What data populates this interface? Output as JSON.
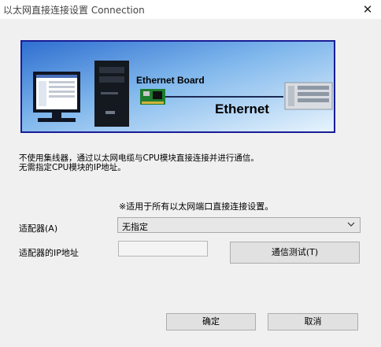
{
  "window": {
    "title": "以太网直接连接设置 Connection",
    "close_glyph": "✕"
  },
  "banner": {
    "board_label": "Ethernet Board",
    "network_label": "Ethernet"
  },
  "description": {
    "line1": "不使用集线器，通过以太网电缆与CPU模块直接连接并进行通信。",
    "line2": "无需指定CPU模块的IP地址。"
  },
  "note": "※适用于所有以太网端口直接连接设置。",
  "adapter": {
    "label": "适配器(A)",
    "selected": "无指定"
  },
  "ip_address": {
    "label": "适配器的IP地址",
    "value": ""
  },
  "buttons": {
    "test": "通信测试(T)",
    "ok": "确定",
    "cancel": "取消"
  }
}
